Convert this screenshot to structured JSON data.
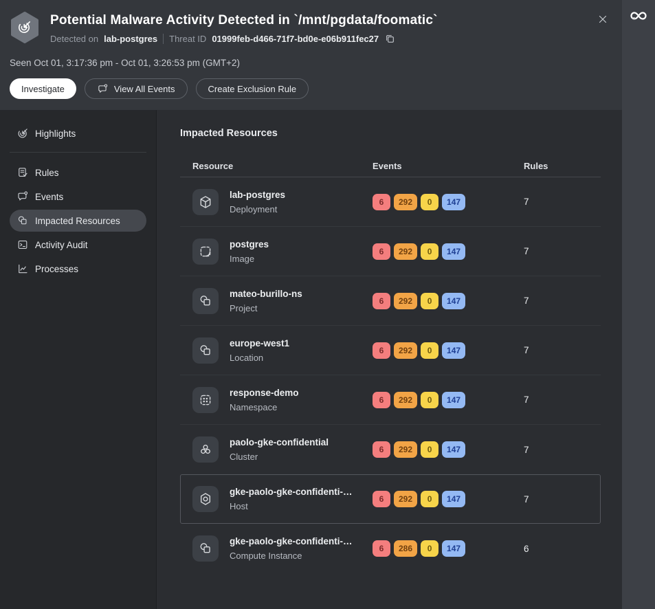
{
  "header": {
    "title": "Potential Malware Activity Detected in `/mnt/pgdata/foomatic`",
    "detected_on_label": "Detected on",
    "detected_on_value": "lab-postgres",
    "threat_id_label": "Threat ID",
    "threat_id_value": "01999feb-d466-71f7-bd0e-e06b911fec27",
    "copy_icon": "copy-icon",
    "close_icon": "close-icon",
    "threat_icon": "malware-threat-icon",
    "seen": "Seen Oct 01, 3:17:36 pm - Oct 01, 3:26:53 pm (GMT+2)",
    "buttons": {
      "investigate": "Investigate",
      "view_all_events": "View All Events",
      "view_all_events_icon": "events-icon",
      "create_exclusion_rule": "Create Exclusion Rule"
    }
  },
  "sidebar": {
    "items": [
      {
        "label": "Highlights",
        "icon": "highlights-icon",
        "selected": false,
        "divider_after": true
      },
      {
        "label": "Rules",
        "icon": "rules-icon",
        "selected": false
      },
      {
        "label": "Events",
        "icon": "events-icon",
        "selected": false
      },
      {
        "label": "Impacted Resources",
        "icon": "resources-icon",
        "selected": true
      },
      {
        "label": "Activity Audit",
        "icon": "audit-icon",
        "selected": false
      },
      {
        "label": "Processes",
        "icon": "processes-icon",
        "selected": false
      }
    ]
  },
  "main": {
    "title": "Impacted Resources",
    "table": {
      "columns": [
        "Resource",
        "Events",
        "Rules"
      ],
      "severity_order": [
        "critical",
        "high",
        "medium",
        "low"
      ],
      "rows": [
        {
          "name": "lab-postgres",
          "type": "Deployment",
          "icon": "deployment-icon",
          "events": [
            6,
            292,
            0,
            147
          ],
          "rules": "7",
          "selected": false
        },
        {
          "name": "postgres",
          "type": "Image",
          "icon": "image-icon",
          "events": [
            6,
            292,
            0,
            147
          ],
          "rules": "7",
          "selected": false
        },
        {
          "name": "mateo-burillo-ns",
          "type": "Project",
          "icon": "project-icon",
          "events": [
            6,
            292,
            0,
            147
          ],
          "rules": "7",
          "selected": false
        },
        {
          "name": "europe-west1",
          "type": "Location",
          "icon": "location-icon",
          "events": [
            6,
            292,
            0,
            147
          ],
          "rules": "7",
          "selected": false
        },
        {
          "name": "response-demo",
          "type": "Namespace",
          "icon": "namespace-icon",
          "events": [
            6,
            292,
            0,
            147
          ],
          "rules": "7",
          "selected": false
        },
        {
          "name": "paolo-gke-confidential",
          "type": "Cluster",
          "icon": "cluster-icon",
          "events": [
            6,
            292,
            0,
            147
          ],
          "rules": "7",
          "selected": false
        },
        {
          "name": "gke-paolo-gke-confidenti-…",
          "type": "Host",
          "icon": "host-icon",
          "events": [
            6,
            292,
            0,
            147
          ],
          "rules": "7",
          "selected": true
        },
        {
          "name": "gke-paolo-gke-confidenti-…",
          "type": "Compute Instance",
          "icon": "compute-instance-icon",
          "events": [
            6,
            286,
            0,
            147
          ],
          "rules": "6",
          "selected": false
        }
      ]
    }
  },
  "app_strip": {
    "logo": "sysdig-logo"
  },
  "colors": {
    "header_bg": "#34373c",
    "sidebar_bg": "#26282b",
    "content_bg": "#2b2d31",
    "strip_bg": "#3d4046",
    "severity_critical": "#F47E7E",
    "severity_high": "#F2A446",
    "severity_medium": "#F7D44A",
    "severity_low": "#94B9F3"
  }
}
